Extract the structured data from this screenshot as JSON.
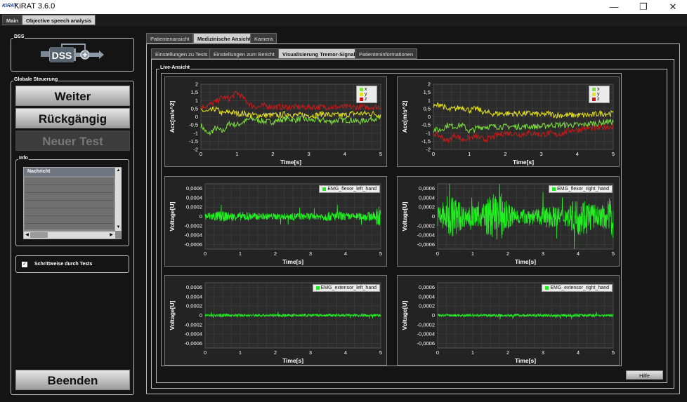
{
  "window": {
    "logo": "KiRAT",
    "title": "KiRAT 3.6.0",
    "minimize_glyph": "—",
    "maximize_glyph": "❐",
    "close_glyph": "✕"
  },
  "main_tabs": [
    {
      "label": "Main"
    },
    {
      "label": "Objective speech analysis"
    }
  ],
  "dss": {
    "label": "DSS",
    "logo_text": "DSS"
  },
  "global_control": {
    "label": "Globale Steuerung",
    "next_label": "Weiter",
    "undo_label": "Rückgängig",
    "new_test_label": "Neuer Test",
    "quit_label": "Beenden"
  },
  "info": {
    "label": "Info",
    "column_header": "Nachricht"
  },
  "stepwise": {
    "label": "Schrittweise durch Tests",
    "checked": true
  },
  "view_tabs": [
    {
      "label": "Patientenansicht"
    },
    {
      "label": "Medizinische Ansicht"
    },
    {
      "label": "Kamera"
    }
  ],
  "sub_tabs": [
    {
      "label": "Einstellungen zu Tests"
    },
    {
      "label": "Einstellungen zum Bericht"
    },
    {
      "label": "Visualisierung Tremor-Signale"
    },
    {
      "label": "Patienteninformationen"
    }
  ],
  "live_label": "Live-Ansicht",
  "help_label": "Hilfe",
  "colors": {
    "x": "#7ee03c",
    "y": "#e8e41a",
    "z": "#d01818",
    "emg": "#22ee22"
  },
  "chart_data": [
    {
      "type": "line",
      "ylabel": "Acc[m/s^2]",
      "xlabel": "Time[s]",
      "x_ticks": [
        "0",
        "1",
        "2",
        "3",
        "4",
        "5"
      ],
      "y_ticks": [
        "2",
        "1,5",
        "1",
        "0,5",
        "0",
        "-0,5",
        "-1",
        "-1,5",
        "-2"
      ],
      "xlim": [
        0,
        5
      ],
      "ylim": [
        -2,
        2
      ],
      "legend": [
        "x",
        "y",
        "z"
      ],
      "series": [
        {
          "name": "x",
          "values": [
            -0.5,
            -1.1,
            -0.7,
            -0.9,
            -0.4,
            -0.5,
            -0.3,
            -0.1,
            -0.2,
            -0.3,
            -0.3,
            -0.2,
            -0.1,
            -0.2,
            -0.1,
            -0.2,
            -0.2,
            -0.2,
            -0.3,
            -0.2,
            -0.2,
            -0.2,
            -0.3,
            -0.2,
            -0.1,
            -0.1
          ]
        },
        {
          "name": "y",
          "values": [
            0.4,
            0.3,
            0.5,
            0.2,
            0.3,
            0.2,
            0.2,
            0.1,
            0.1,
            0.1,
            0.1,
            0.1,
            0.2,
            0.1,
            0.1,
            0.1,
            0.1,
            0.2,
            0.1,
            0.1,
            0.1,
            0.2,
            0.2,
            0.2,
            0.2,
            0.1
          ]
        },
        {
          "name": "z",
          "values": [
            0.6,
            0.7,
            0.9,
            1.2,
            1.1,
            1.5,
            1.1,
            0.7,
            0.6,
            0.7,
            0.6,
            0.6,
            0.6,
            0.6,
            0.6,
            0.6,
            0.6,
            0.6,
            0.6,
            0.6,
            0.6,
            0.6,
            0.6,
            0.6,
            0.6,
            0.6
          ]
        }
      ]
    },
    {
      "type": "line",
      "ylabel": "Acc[m/s^2]",
      "xlabel": "Time[s]",
      "x_ticks": [
        "0",
        "1",
        "2",
        "3",
        "4",
        "5"
      ],
      "y_ticks": [
        "2",
        "1,5",
        "1",
        "0,5",
        "0",
        "-0,5",
        "-1",
        "-1,5",
        "-2"
      ],
      "xlim": [
        0,
        5
      ],
      "ylim": [
        -2,
        2
      ],
      "legend": [
        "x",
        "y",
        "z"
      ],
      "series": [
        {
          "name": "x",
          "values": [
            -0.8,
            -0.8,
            -0.5,
            -0.6,
            -0.5,
            -0.9,
            -0.7,
            -0.6,
            -0.6,
            -0.6,
            -0.6,
            -0.6,
            -0.6,
            -0.6,
            -0.6,
            -0.6,
            -0.5,
            -0.5,
            -0.5,
            -0.5,
            -0.5,
            -0.5,
            -0.4,
            -0.4,
            -0.3,
            -0.3
          ]
        },
        {
          "name": "y",
          "values": [
            0.6,
            0.8,
            0.4,
            0.5,
            0.6,
            0.4,
            0.5,
            0.3,
            0.2,
            0.2,
            0.2,
            0.2,
            0.2,
            0.2,
            0.2,
            0.1,
            0.2,
            0.1,
            0.1,
            0.1,
            0.1,
            0.1,
            0.1,
            0.2,
            0.2,
            0.2
          ]
        },
        {
          "name": "z",
          "values": [
            -1.0,
            -1.2,
            -1.5,
            -1.1,
            -1.4,
            -1.3,
            -1.2,
            -1.4,
            -1.3,
            -1.1,
            -1.0,
            -1.0,
            -1.1,
            -1.0,
            -1.0,
            -1.1,
            -1.0,
            -1.1,
            -1.0,
            -0.8,
            -0.8,
            -0.7,
            -0.7,
            -0.7,
            -0.6,
            -0.6
          ]
        }
      ]
    },
    {
      "type": "line",
      "ylabel": "Voltage[U]",
      "xlabel": "Time[s]",
      "x_ticks": [
        "0",
        "1",
        "2",
        "3",
        "4",
        "5"
      ],
      "y_ticks": [
        "0,0006",
        "0,0004",
        "0,0002",
        "0",
        "-0,0002",
        "-0,0004",
        "-0,0006"
      ],
      "xlim": [
        0,
        5
      ],
      "ylim": [
        -0.0007,
        0.0007
      ],
      "legend": [
        "EMG_flexor_left_hand"
      ],
      "series": [
        {
          "name": "EMG_flexor_left_hand",
          "amplitude": [
            8e-05,
            0.0001,
            0.00012,
            0.0001,
            8e-05,
            9e-05,
            0.0001,
            8e-05,
            7e-05,
            7e-05,
            7e-05,
            7e-05,
            7e-05,
            8e-05,
            7e-05,
            8e-05,
            6e-05,
            0.0001,
            0.0001,
            0.0001,
            8e-05,
            7e-05,
            8e-05,
            0.0001,
            0.0001,
            0.0003
          ]
        }
      ]
    },
    {
      "type": "line",
      "ylabel": "Voltage[U]",
      "xlabel": "Time[s]",
      "x_ticks": [
        "0",
        "1",
        "2",
        "3",
        "4",
        "5"
      ],
      "y_ticks": [
        "0,0006",
        "0,0004",
        "0,0002",
        "0",
        "-0,0002",
        "-0,0004",
        "-0,0006"
      ],
      "xlim": [
        0,
        5
      ],
      "ylim": [
        -0.0007,
        0.0007
      ],
      "legend": [
        "EMG_flexor_right_hand"
      ],
      "series": [
        {
          "name": "EMG_flexor_right_hand",
          "amplitude": [
            0.0002,
            0.0004,
            0.0005,
            0.00035,
            0.0002,
            0.00025,
            0.0002,
            0.0004,
            0.0005,
            0.0005,
            0.0003,
            0.0002,
            0.00015,
            0.0002,
            0.00015,
            0.0002,
            0.00025,
            0.0002,
            0.0002,
            0.0003,
            0.0004,
            0.0004,
            0.0003,
            0.0002,
            0.0003,
            0.0005
          ]
        }
      ]
    },
    {
      "type": "line",
      "ylabel": "Voltage[U]",
      "xlabel": "Time[s]",
      "x_ticks": [
        "0",
        "1",
        "2",
        "3",
        "4",
        "5"
      ],
      "y_ticks": [
        "0,0006",
        "0,0004",
        "0,0002",
        "0",
        "-0,0002",
        "-0,0004",
        "-0,0006"
      ],
      "xlim": [
        0,
        5
      ],
      "ylim": [
        -0.0007,
        0.0007
      ],
      "legend": [
        "EMG_extensor_left_hand"
      ],
      "series": [
        {
          "name": "EMG_extensor_left_hand",
          "amplitude": [
            3e-05,
            3e-05,
            3e-05,
            3e-05,
            3e-05,
            3e-05,
            3e-05,
            3e-05,
            3e-05,
            3e-05,
            3e-05,
            3e-05,
            3e-05,
            3e-05,
            3e-05,
            3e-05,
            3e-05,
            3e-05,
            3e-05,
            3e-05,
            3e-05,
            3e-05,
            3e-05,
            3e-05,
            3e-05,
            3e-05
          ]
        }
      ]
    },
    {
      "type": "line",
      "ylabel": "Voltage[U]",
      "xlabel": "Time[s]",
      "x_ticks": [
        "0",
        "1",
        "2",
        "3",
        "4",
        "5"
      ],
      "y_ticks": [
        "0,0006",
        "0,0004",
        "0,0002",
        "0",
        "-0,0002",
        "-0,0004",
        "-0,0006"
      ],
      "xlim": [
        0,
        5
      ],
      "ylim": [
        -0.0007,
        0.0007
      ],
      "legend": [
        "EMG_extensor_right_hand"
      ],
      "series": [
        {
          "name": "EMG_extensor_right_hand",
          "amplitude": [
            3e-05,
            3e-05,
            3e-05,
            3e-05,
            3e-05,
            3e-05,
            3e-05,
            3e-05,
            3e-05,
            3e-05,
            3e-05,
            3e-05,
            3e-05,
            3e-05,
            3e-05,
            3e-05,
            3e-05,
            3e-05,
            3e-05,
            3e-05,
            3e-05,
            3e-05,
            3e-05,
            3e-05,
            3e-05,
            3e-05
          ]
        }
      ]
    }
  ]
}
